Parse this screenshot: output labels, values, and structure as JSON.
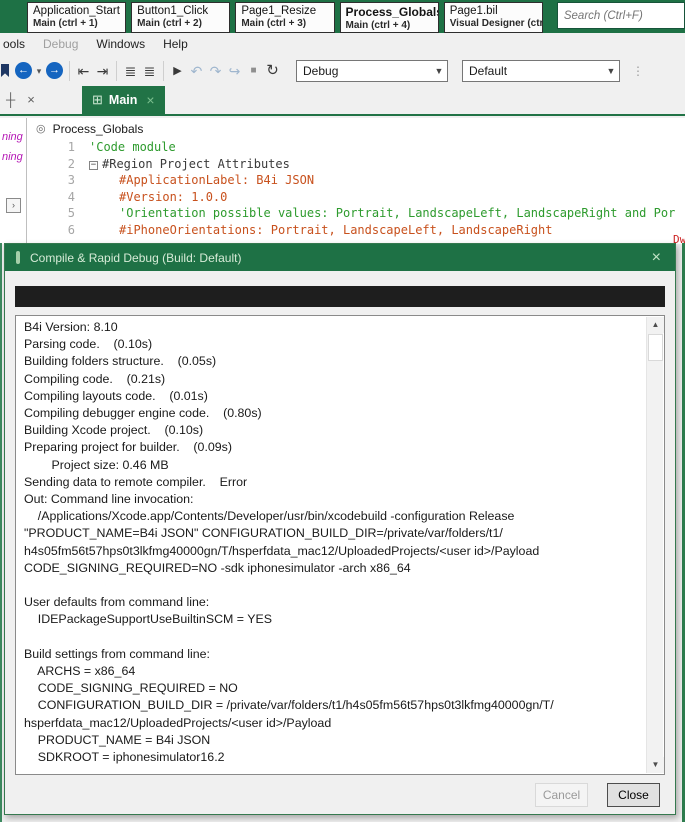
{
  "header": {
    "tabs": [
      {
        "title": "Application_Start",
        "subtitle": "Main (ctrl + 1)"
      },
      {
        "title": "Button1_Click",
        "subtitle": "Main (ctrl + 2)"
      },
      {
        "title": "Page1_Resize",
        "subtitle": "Main (ctrl + 3)"
      },
      {
        "title": "Process_Globals",
        "subtitle": "Main (ctrl + 4)"
      },
      {
        "title": "Page1.bil",
        "subtitle": "Visual Designer (ctr"
      }
    ],
    "search_placeholder": "Search (Ctrl+F)"
  },
  "menubar": {
    "items": [
      {
        "label": "ools"
      },
      {
        "label": "Debug"
      },
      {
        "label": "Windows"
      },
      {
        "label": "Help"
      }
    ]
  },
  "toolbar": {
    "icons": [
      {
        "name": "navigate-back-icon",
        "glyph": "←"
      },
      {
        "name": "back-history-caret-icon",
        "glyph": "▾"
      },
      {
        "name": "navigate-forward-icon",
        "glyph": "→"
      },
      {
        "name": "indent-decrease-icon",
        "glyph": "⇤"
      },
      {
        "name": "indent-increase-icon",
        "glyph": "⇥"
      },
      {
        "name": "comment-icon",
        "glyph": "≣"
      },
      {
        "name": "uncomment-icon",
        "glyph": "≣"
      },
      {
        "name": "run-icon",
        "glyph": "▶"
      },
      {
        "name": "step-into-icon",
        "glyph": "↶"
      },
      {
        "name": "step-over-icon",
        "glyph": "↷"
      },
      {
        "name": "step-out-icon",
        "glyph": "↪"
      },
      {
        "name": "stop-icon",
        "glyph": "■"
      },
      {
        "name": "rebuild-icon",
        "glyph": "↻"
      },
      {
        "name": "toolbar-grip-icon",
        "glyph": "⋮"
      }
    ],
    "config_dropdown_value": "Debug",
    "build_dropdown_value": "Default"
  },
  "tabstrip": {
    "pin_glyph": "┼",
    "panel_close_glyph": "×",
    "main_tab": {
      "icon_glyph": "⊞",
      "label": "Main",
      "close_glyph": "×"
    }
  },
  "editor": {
    "breadcrumb_icon": "◎",
    "breadcrumb": "Process_Globals",
    "warnings": [
      "ning",
      "ning"
    ],
    "expander_glyph": "›",
    "collapse_glyph": "−",
    "lines": [
      {
        "num": "1",
        "text": "'Code module"
      },
      {
        "num": "2",
        "text": "#Region  Project Attributes"
      },
      {
        "num": "3",
        "text": "#ApplicationLabel: B4i JSON"
      },
      {
        "num": "4",
        "text": "#Version: 1.0.0"
      },
      {
        "num": "5",
        "text": "'Orientation possible values: Portrait, LandscapeLeft, LandscapeRight and Por"
      },
      {
        "num": "6",
        "text": "#iPhoneOrientations: Portrait, LandscapeLeft, LandscapeRight"
      }
    ],
    "clipped_right_text": "Dw"
  },
  "dialog": {
    "title": "Compile & Rapid Debug (Build: Default)",
    "close_glyph": "×",
    "scroll_up_glyph": "▲",
    "scroll_down_glyph": "▼",
    "log_text": "B4i Version: 8.10\nParsing code.    (0.10s)\nBuilding folders structure.    (0.05s)\nCompiling code.    (0.21s)\nCompiling layouts code.    (0.01s)\nCompiling debugger engine code.    (0.80s)\nBuilding Xcode project.    (0.10s)\nPreparing project for builder.    (0.09s)\n        Project size: 0.46 MB\nSending data to remote compiler.    Error\nOut: Command line invocation:\n    /Applications/Xcode.app/Contents/Developer/usr/bin/xcodebuild -configuration Release\n\"PRODUCT_NAME=B4i JSON\" CONFIGURATION_BUILD_DIR=/private/var/folders/t1/\nh4s05fm56t57hps0t3lkfmg40000gn/T/hsperfdata_mac12/UploadedProjects/<user id>/Payload\nCODE_SIGNING_REQUIRED=NO -sdk iphonesimulator -arch x86_64\n\nUser defaults from command line:\n    IDEPackageSupportUseBuiltinSCM = YES\n\nBuild settings from command line:\n    ARCHS = x86_64\n    CODE_SIGNING_REQUIRED = NO\n    CONFIGURATION_BUILD_DIR = /private/var/folders/t1/h4s05fm56t57hps0t3lkfmg40000gn/T/\nhsperfdata_mac12/UploadedProjects/<user id>/Payload\n    PRODUCT_NAME = B4i JSON\n    SDKROOT = iphonesimulator16.2",
    "cancel_label": "Cancel",
    "close_label": "Close"
  },
  "colors": {
    "brand_green": "#1E7145",
    "tab_green": "#217346",
    "comment_green": "#2E9B2E",
    "attribute_orange": "#C8511D",
    "warning_magenta": "#B518B5",
    "progress_black": "#1E1E1E"
  }
}
